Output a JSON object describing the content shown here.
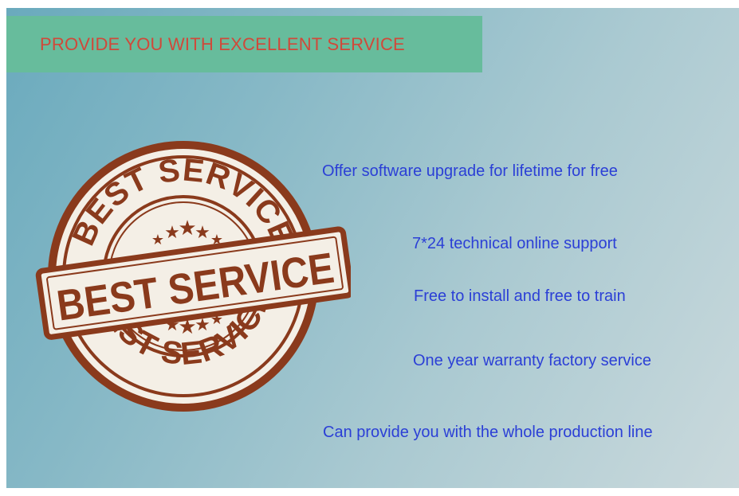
{
  "banner": {
    "title": "PROVIDE YOU WITH EXCELLENT SERVICE"
  },
  "stamp": {
    "top_arc": "BEST SERVICE",
    "center": "BEST SERVICE",
    "bottom_arc": "BEST SERVICE",
    "color": "#8a3a1c",
    "icon": "best-service-stamp"
  },
  "features": [
    "Offer software upgrade for lifetime for free",
    "7*24 technical online support",
    "Free to install and free to train",
    "One year warranty factory service",
    "Can provide you with the whole production line"
  ],
  "colors": {
    "banner_bg": "#67bc9c",
    "banner_text": "#d0493a",
    "feature_text": "#2b3fd6"
  }
}
